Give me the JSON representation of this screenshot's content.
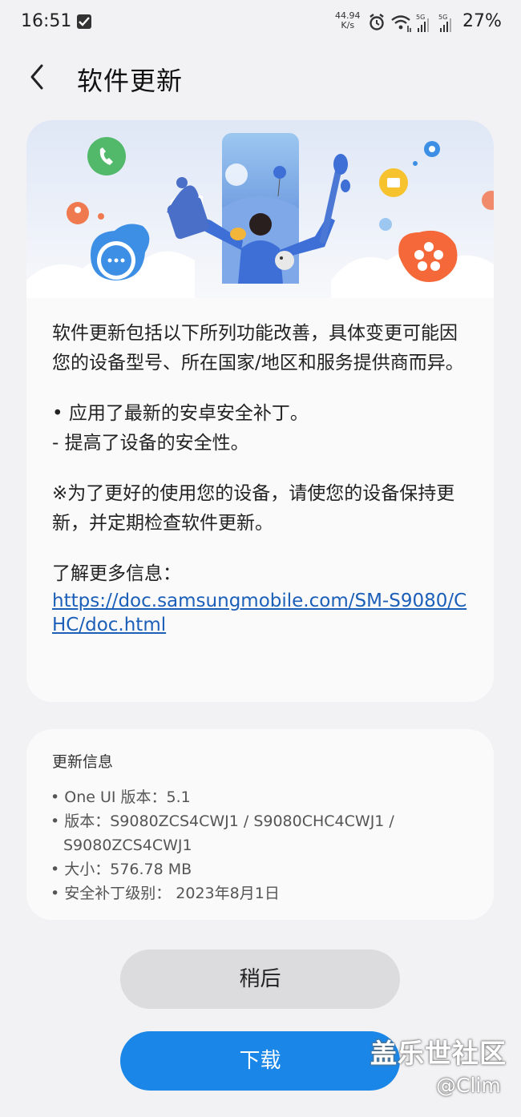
{
  "status_bar": {
    "time": "16:51",
    "net_speed_value": "44.94",
    "net_speed_unit": "K/s",
    "battery": "27%",
    "signal_labels": [
      "5G",
      "5G"
    ]
  },
  "header": {
    "title": "软件更新"
  },
  "description": {
    "intro": "软件更新包括以下所列功能改善，具体变更可能因您的设备型号、所在国家/地区和服务提供商而异。",
    "bullet1": "• 应用了最新的安卓安全补丁。",
    "bullet1_sub": " - 提高了设备的安全性。",
    "note": "※为了更好的使用您的设备，请使您的设备保持更新，并定期检查软件更新。",
    "more_info_label": "了解更多信息：",
    "link": "https://doc.samsungmobile.com/SM-S9080/CHC/doc.html"
  },
  "update_info": {
    "title": "更新信息",
    "one_ui": "• One UI 版本：5.1",
    "version_line1": "• 版本：S9080ZCS4CWJ1 / S9080CHC4CWJ1 /",
    "version_line2": "S9080ZCS4CWJ1",
    "size": "• 大小：576.78 MB",
    "security_patch": "• 安全补丁级别： 2023年8月1日"
  },
  "buttons": {
    "later": "稍后",
    "download": "下载"
  },
  "watermark": {
    "line1": "盖乐世社区",
    "line2": "@Clim"
  },
  "colors": {
    "background": "#f2f2f4",
    "card": "#fafafb",
    "link": "#1b5fb8",
    "download_button": "#1a87e8",
    "later_button": "#dcdcde"
  }
}
